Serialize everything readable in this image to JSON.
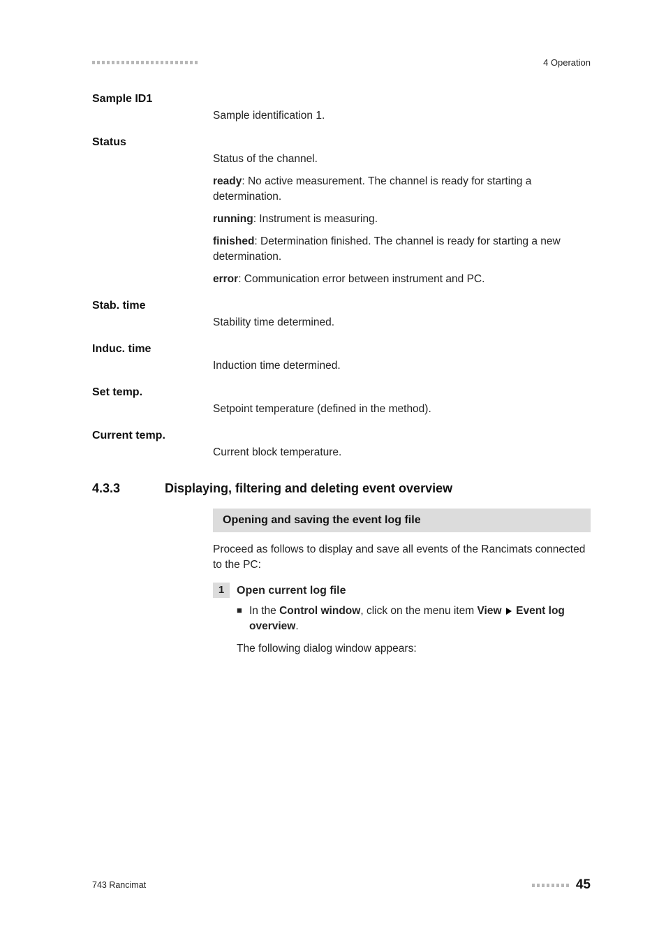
{
  "header": {
    "chapter": "4 Operation"
  },
  "definitions": {
    "sample_id1": {
      "term": "Sample ID1",
      "body": "Sample identification 1."
    },
    "status": {
      "term": "Status",
      "intro": "Status of the channel.",
      "ready_label": "ready",
      "ready_text": ": No active measurement. The channel is ready for starting a determination.",
      "running_label": "running",
      "running_text": ": Instrument is measuring.",
      "finished_label": "finished",
      "finished_text": ": Determination finished. The channel is ready for starting a new determination.",
      "error_label": "error",
      "error_text": ": Communication error between instrument and PC."
    },
    "stab_time": {
      "term": "Stab. time",
      "body": "Stability time determined."
    },
    "induc_time": {
      "term": "Induc. time",
      "body": "Induction time determined."
    },
    "set_temp": {
      "term": "Set temp.",
      "body": "Setpoint temperature (defined in the method)."
    },
    "current_temp": {
      "term": "Current temp.",
      "body": "Current block temperature."
    }
  },
  "section": {
    "number": "4.3.3",
    "title": "Displaying, filtering and deleting event overview",
    "subheader": "Opening and saving the event log file",
    "intro": "Proceed as follows to display and save all events of the Rancimats connected to the PC:",
    "step_num": "1",
    "step_title": "Open current log file",
    "bullet_pre": "In the ",
    "bullet_b1": "Control window",
    "bullet_mid1": ", click on the menu item ",
    "bullet_b2": "View",
    "bullet_b3": "Event log overview",
    "bullet_end": ".",
    "after_step": "The following dialog window appears:"
  },
  "footer": {
    "product": "743 Rancimat",
    "page": "45"
  }
}
